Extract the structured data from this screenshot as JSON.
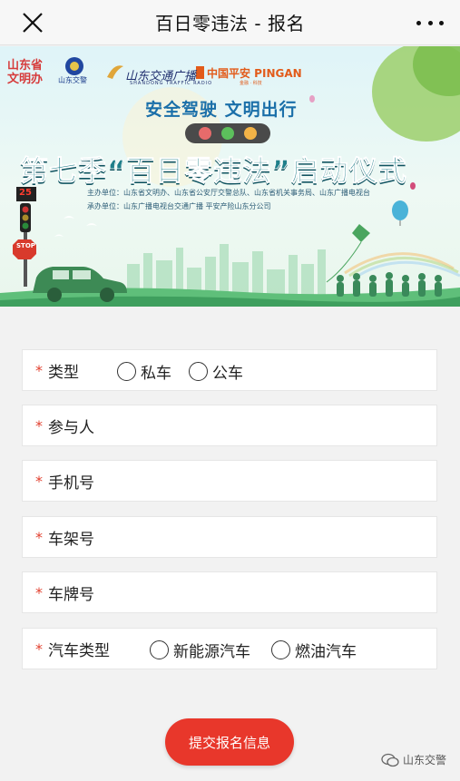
{
  "navbar": {
    "title": "百日零违法 - 报名",
    "close_icon": "close-icon",
    "more_icon": "more-dots-icon"
  },
  "banner": {
    "logos": {
      "wenming": "山东省文明办",
      "jiaojing": "山东交警",
      "radio": "山东交通广播",
      "radio_sub": "SHANDONG TRAFFIC RADIO",
      "pingan": "中国平安 PINGAN",
      "pingan_sub": "金融 · 科技"
    },
    "slogan": "安全驾驶 文明出行",
    "headline": "第七季“百日零违法”启动仪式",
    "organizer": "主办单位：山东省文明办、山东省公安厅交警总队、山东省机关事务局、山东广播电视台",
    "coorganizer": "承办单位：山东广播电视台交通广播 平安产险山东分公司",
    "signal_number": "25",
    "stop_sign": "STOP"
  },
  "form": {
    "required_mark": "*",
    "type": {
      "label": "类型",
      "options": [
        "私车",
        "公车"
      ]
    },
    "participant": {
      "label": "参与人",
      "value": ""
    },
    "phone": {
      "label": "手机号",
      "value": ""
    },
    "frame_number": {
      "label": "车架号",
      "value": ""
    },
    "plate_number": {
      "label": "车牌号",
      "value": ""
    },
    "car_type": {
      "label": "汽车类型",
      "options": [
        "新能源汽车",
        "燃油汽车"
      ]
    }
  },
  "submit": {
    "label": "提交报名信息"
  },
  "watermark": {
    "text": "山东交警",
    "icon": "wechat-channel-icon"
  },
  "colors": {
    "accent": "#e8372b",
    "required": "#e2402f",
    "headline": "#1f7f8a"
  }
}
